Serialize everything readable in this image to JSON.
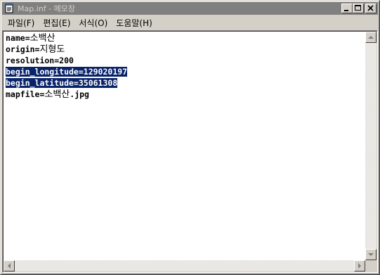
{
  "window": {
    "title": "Map.inf - 메모장",
    "icon": "notepad-icon",
    "buttons": [
      "minimize-icon",
      "maximize-icon",
      "close-icon"
    ]
  },
  "menu": [
    {
      "label": "파일(F)"
    },
    {
      "label": "편집(E)"
    },
    {
      "label": "서식(O)"
    },
    {
      "label": "도움말(H)"
    }
  ],
  "content": {
    "lines": [
      {
        "key": "name=",
        "value": "소백산",
        "selected": false
      },
      {
        "key": "origin=",
        "value": "지형도",
        "selected": false
      },
      {
        "key": "resolution=200",
        "value": "",
        "selected": false
      },
      {
        "key": "begin_longitude=129020197",
        "value": "",
        "selected": true
      },
      {
        "key": "begin_latitude=35061308",
        "value": "",
        "selected": true
      },
      {
        "key": "mapfile=",
        "value": "소백산",
        "suffix": ".jpg",
        "selected": false
      }
    ]
  },
  "colors": {
    "titlebar_inactive": "#808080",
    "selection": "#0a246a",
    "face": "#d4d0c8"
  }
}
